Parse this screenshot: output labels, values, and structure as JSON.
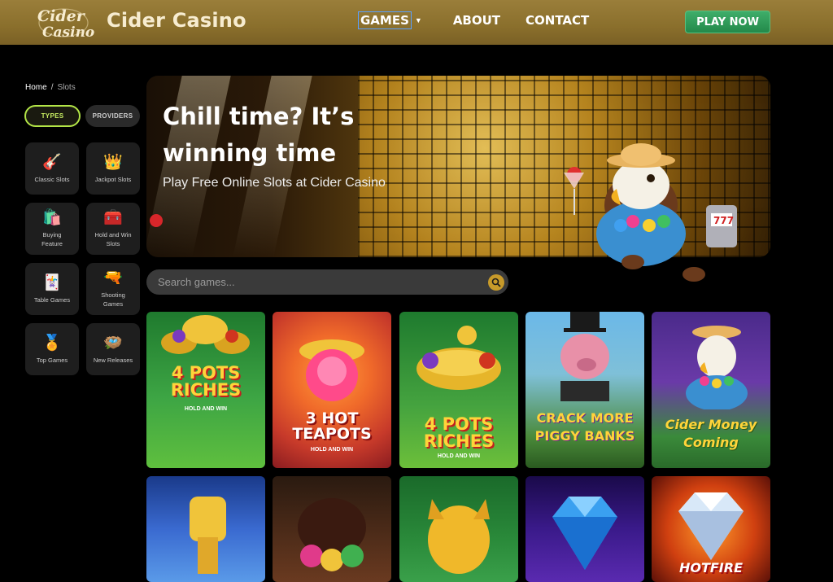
{
  "header": {
    "logo_text": "Cider Casino",
    "brand": "Cider Casino",
    "nav": [
      {
        "label": "GAMES",
        "has_dropdown": true
      },
      {
        "label": "ABOUT"
      },
      {
        "label": "CONTACT"
      }
    ],
    "cta": "PLAY NOW",
    "colors": {
      "bar": "#8a6f2c",
      "cta": "#2c9a57"
    }
  },
  "sidebar": {
    "breadcrumb": {
      "home": "Home",
      "separator": "/",
      "current": "Slots"
    },
    "filters": [
      {
        "label": "TYPES",
        "active": true
      },
      {
        "label": "PROVIDERS",
        "active": false
      }
    ],
    "categories": [
      {
        "label": "Classic Slots",
        "icon": "guitar-icon"
      },
      {
        "label": "Jackpot Slots",
        "icon": "crown-icon"
      },
      {
        "label": "Buying Feature",
        "icon": "shopping-bags-icon"
      },
      {
        "label": "Hold and Win Slots",
        "icon": "treasure-chest-icon"
      },
      {
        "label": "Table Games",
        "icon": "playing-cards-icon"
      },
      {
        "label": "Shooting Games",
        "icon": "blaster-icon"
      },
      {
        "label": "Top Games",
        "icon": "medal-icon"
      },
      {
        "label": "New Releases",
        "icon": "nest-eggs-icon"
      }
    ]
  },
  "hero": {
    "headline": "Chill time? It’s winning time",
    "subheadline": "Play Free Online Slots at Cider Casino"
  },
  "search": {
    "placeholder": "Search games...",
    "icon": "search-icon"
  },
  "games": [
    {
      "title": "4 POTS RICHES",
      "subtitle": "HOLD AND WIN"
    },
    {
      "title": "3 HOT TEAPOTS",
      "subtitle": "HOLD AND WIN"
    },
    {
      "title": "4 POTS RICHES",
      "subtitle": "HOLD AND WIN"
    },
    {
      "title": "CRACK MORE PIGGY BANKS",
      "subtitle": ""
    },
    {
      "title": "Cider Money Coming",
      "subtitle": ""
    },
    {
      "title": "",
      "subtitle": ""
    },
    {
      "title": "",
      "subtitle": ""
    },
    {
      "title": "",
      "subtitle": ""
    },
    {
      "title": "",
      "subtitle": ""
    },
    {
      "title": "HOTFIRE",
      "subtitle": ""
    }
  ]
}
